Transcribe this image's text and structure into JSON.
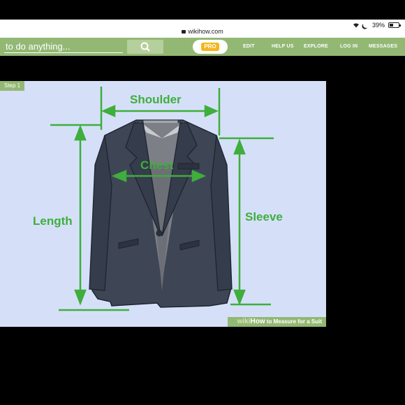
{
  "status_bar": {
    "url": "wikihow.com",
    "battery": "39%"
  },
  "navbar": {
    "search_placeholder": "to do anything...",
    "pro_label": "PRO",
    "links": [
      "EDIT",
      "HELP US",
      "EXPLORE",
      "LOG IN",
      "MESSAGES"
    ]
  },
  "image": {
    "step_label": "Step 1",
    "labels": {
      "shoulder": "Shoulder",
      "chest": "Chest",
      "length": "Length",
      "sleeve": "Sleeve"
    },
    "footer_brand_a": "wiki",
    "footer_brand_b": "How",
    "footer_text": " to Measure for a Suit"
  },
  "colors": {
    "nav_green": "#93b874",
    "measure_green": "#3fae3c",
    "jacket": "#3e4656",
    "panel_bg": "#d5e0f8"
  }
}
